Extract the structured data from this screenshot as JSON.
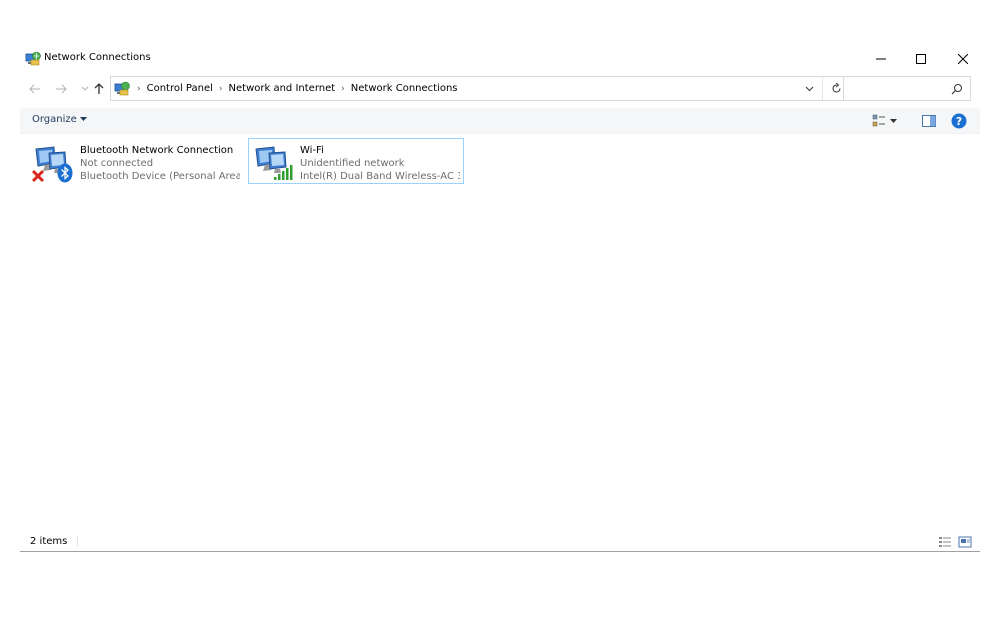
{
  "window": {
    "title": "Network Connections",
    "icon": "network-connections-icon"
  },
  "address": {
    "crumbs": [
      "Control Panel",
      "Network and Internet",
      "Network Connections"
    ],
    "search_placeholder": ""
  },
  "commandbar": {
    "organize_label": "Organize"
  },
  "connections": [
    {
      "name": "Bluetooth Network Connection",
      "status": "Not connected",
      "device": "Bluetooth Device (Personal Area ...",
      "overlay": "bluetooth-icon",
      "state": "disconnected"
    },
    {
      "name": "Wi-Fi",
      "status": "Unidentified network",
      "device": "Intel(R) Dual Band Wireless-AC 31...",
      "overlay": "signal-bars-icon",
      "state": "connected"
    }
  ],
  "statusbar": {
    "count": "2 items"
  },
  "colors": {
    "selection_border": "#99d1ff",
    "commandbar_bg": "#f5f6f7",
    "help_blue": "#1a6fd1",
    "signal_green": "#2fa02f",
    "error_red": "#d9251c"
  }
}
